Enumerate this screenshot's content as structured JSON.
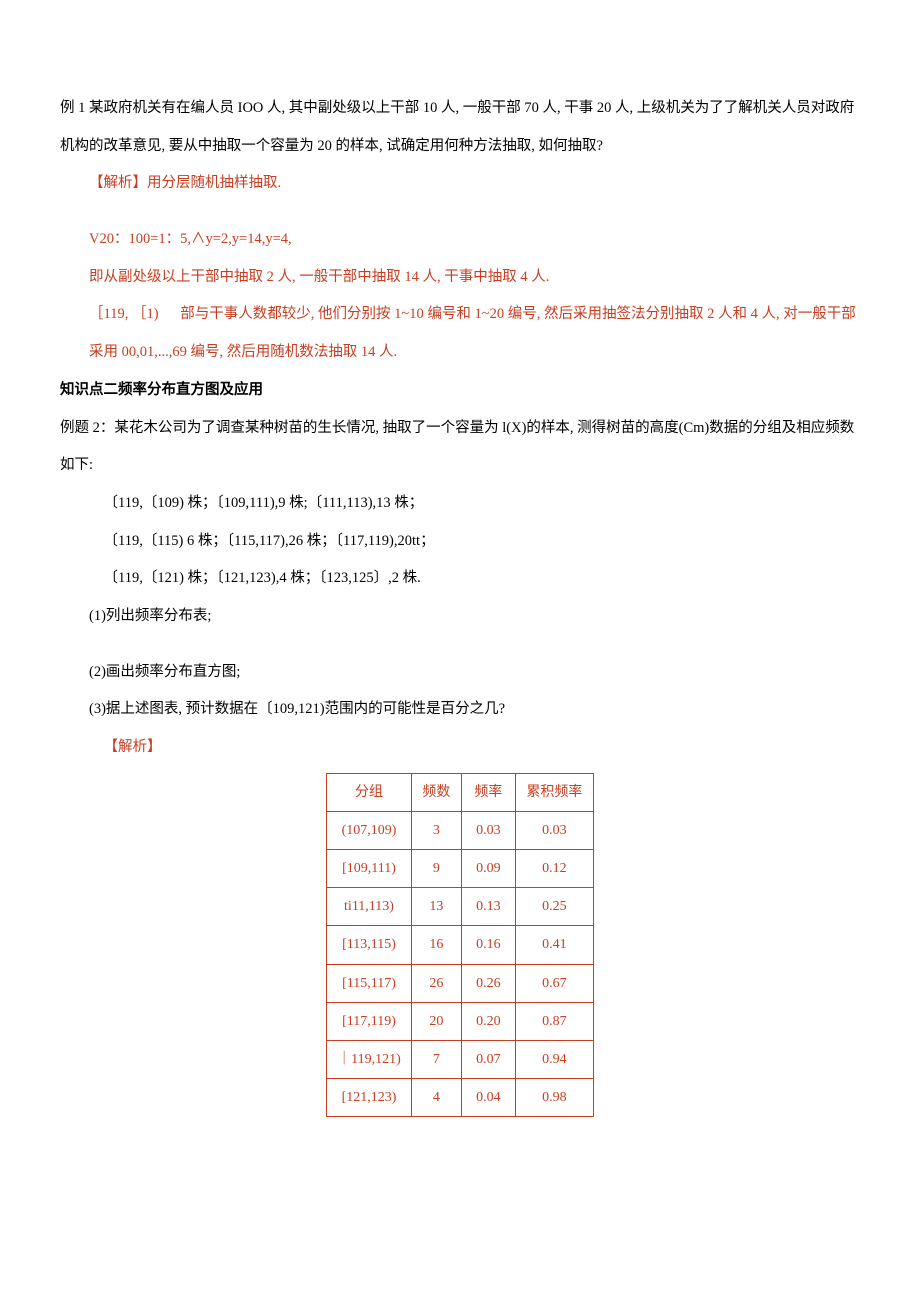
{
  "body": {
    "p1": "例 1 某政府机关有在编人员 IOO 人, 其中副处级以上干部 10 人, 一般干部 70 人, 干事 20 人, 上级机关为了了解机关人员对政府机构的改革意见, 要从中抽取一个容量为 20 的样本, 试确定用何种方法抽取, 如何抽取?",
    "p2": "【解析】用分层随机抽样抽取.",
    "p3": "V20：100=1：5,∧y=2,y=14,y=4,",
    "p4": "即从副处级以上干部中抽取 2 人, 一般干部中抽取 14 人, 干事中抽取 4 人.",
    "p5a": "［119, ［1)",
    "p5b": "部与干事人数都较少, 他们分别按 1~10 编号和 1~20 编号, 然后采用抽签法分别抽取 2 人和 4 人, 对一般干部采用 00,01,...,69 编号, 然后用随机数法抽取 14 人.",
    "h2": "知识点二频率分布直方图及应用",
    "p6": "例题 2：某花木公司为了调查某种树苗的生长情况, 抽取了一个容量为 l(X)的样本, 测得树苗的高度(Cm)数据的分组及相应频数如下:",
    "p7": "〔119,〔109)          株；〔109,111),9 株;〔111,113),13 株；",
    "p8": "〔119,〔115)          6 株；〔115,117),26 株；〔117,119),20tt；",
    "p9": "〔119,〔121)          株；〔121,123),4 株；〔123,125〕,2 株.",
    "p10": "(1)列出频率分布表;",
    "p11": "(2)画出频率分布直方图;",
    "p12": "(3)据上述图表, 预计数据在〔109,121)范围内的可能性是百分之几?",
    "p13": "【解析】"
  },
  "table": {
    "headers": {
      "c1": "分组",
      "c2": "频数",
      "c3": "频率",
      "c4": "累积频率"
    },
    "rows": [
      {
        "group": "(107,109)",
        "freq": "3",
        "rate": "0.03",
        "cum": "0.03"
      },
      {
        "group": "[109,111)",
        "freq": "9",
        "rate": "0.09",
        "cum": "0.12"
      },
      {
        "group": "ti11,113)",
        "freq": "13",
        "rate": "0.13",
        "cum": "0.25"
      },
      {
        "group": "[113,115)",
        "freq": "16",
        "rate": "0.16",
        "cum": "0.41"
      },
      {
        "group": "[115,117)",
        "freq": "26",
        "rate": "0.26",
        "cum": "0.67"
      },
      {
        "group": "[117,119)",
        "freq": "20",
        "rate": "0.20",
        "cum": "0.87"
      },
      {
        "group": "｜119,121)",
        "freq": "7",
        "rate": "0.07",
        "cum": "0.94"
      },
      {
        "group": "[121,123)",
        "freq": "4",
        "rate": "0.04",
        "cum": "0.98"
      }
    ]
  },
  "chart_data": {
    "type": "table",
    "title": "频率分布表",
    "columns": [
      "分组",
      "频数",
      "频率",
      "累积频率"
    ],
    "rows": [
      [
        "(107,109)",
        3,
        0.03,
        0.03
      ],
      [
        "[109,111)",
        9,
        0.09,
        0.12
      ],
      [
        "[111,113)",
        13,
        0.13,
        0.25
      ],
      [
        "[113,115)",
        16,
        0.16,
        0.41
      ],
      [
        "[115,117)",
        26,
        0.26,
        0.67
      ],
      [
        "[117,119)",
        20,
        0.2,
        0.87
      ],
      [
        "[119,121)",
        7,
        0.07,
        0.94
      ],
      [
        "[121,123)",
        4,
        0.04,
        0.98
      ]
    ]
  }
}
